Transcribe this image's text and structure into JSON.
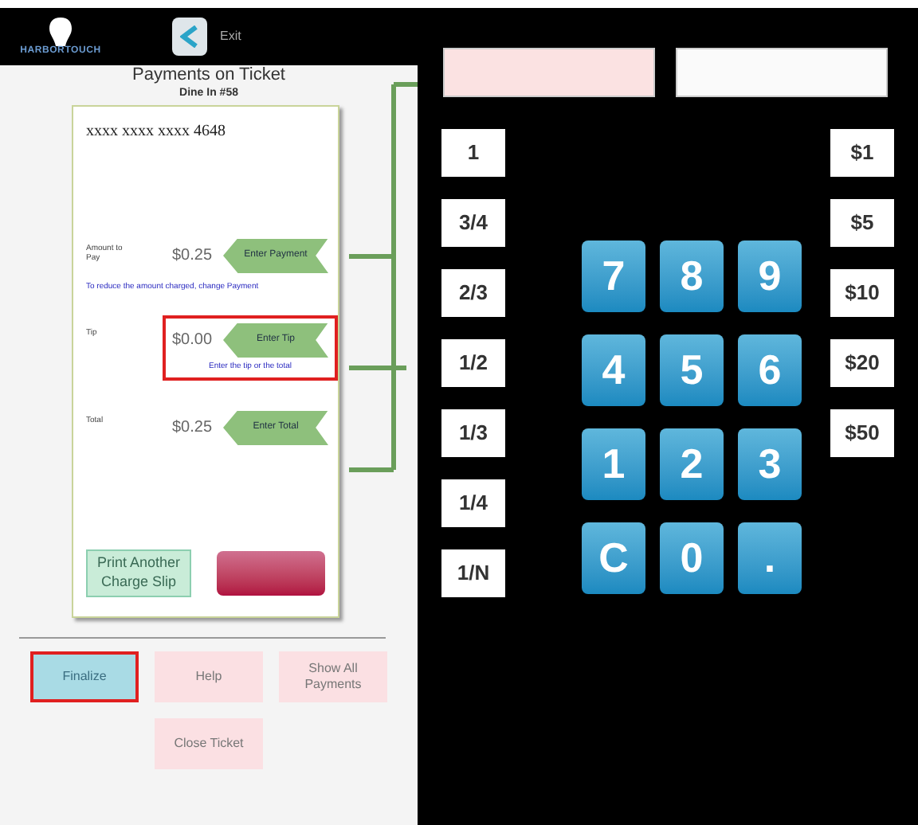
{
  "header": {
    "logo": "HARBORTOUCH",
    "exit_label": "Exit"
  },
  "title": "Payments on Ticket",
  "subtitle": "Dine In #58",
  "card": {
    "number": "xxxx xxxx xxxx 4648",
    "rows": [
      {
        "label": "Amount to Pay",
        "amount": "$0.25",
        "button": "Enter Payment",
        "note": "To reduce the amount charged, change Payment",
        "highlighted": false
      },
      {
        "label": "Tip",
        "amount": "$0.00",
        "button": "Enter Tip",
        "note": "Enter the tip or the total",
        "highlighted": true
      },
      {
        "label": "Total",
        "amount": "$0.25",
        "button": "Enter Total",
        "highlighted": false
      }
    ],
    "buttons": [
      {
        "kind": "print",
        "label": "Print Another Charge Slip"
      },
      {
        "kind": "void"
      }
    ]
  },
  "actions": [
    {
      "label": "Finalize",
      "selected": true
    },
    {
      "label": "Help",
      "selected": false
    },
    {
      "label": "Show All Payments",
      "selected": false
    },
    {
      "label": "Close Ticket",
      "selected": false
    }
  ],
  "fields": [
    {
      "kind": "pink"
    },
    {
      "kind": "white"
    }
  ],
  "fractions": [
    "1",
    "3/4",
    "2/3",
    "1/2",
    "1/3",
    "1/4",
    "1/N"
  ],
  "keypad": [
    "7",
    "8",
    "9",
    "4",
    "5",
    "6",
    "1",
    "2",
    "3",
    "C",
    "0",
    "."
  ],
  "cash": [
    "$1",
    "$5",
    "$10",
    "$20",
    "$50"
  ]
}
